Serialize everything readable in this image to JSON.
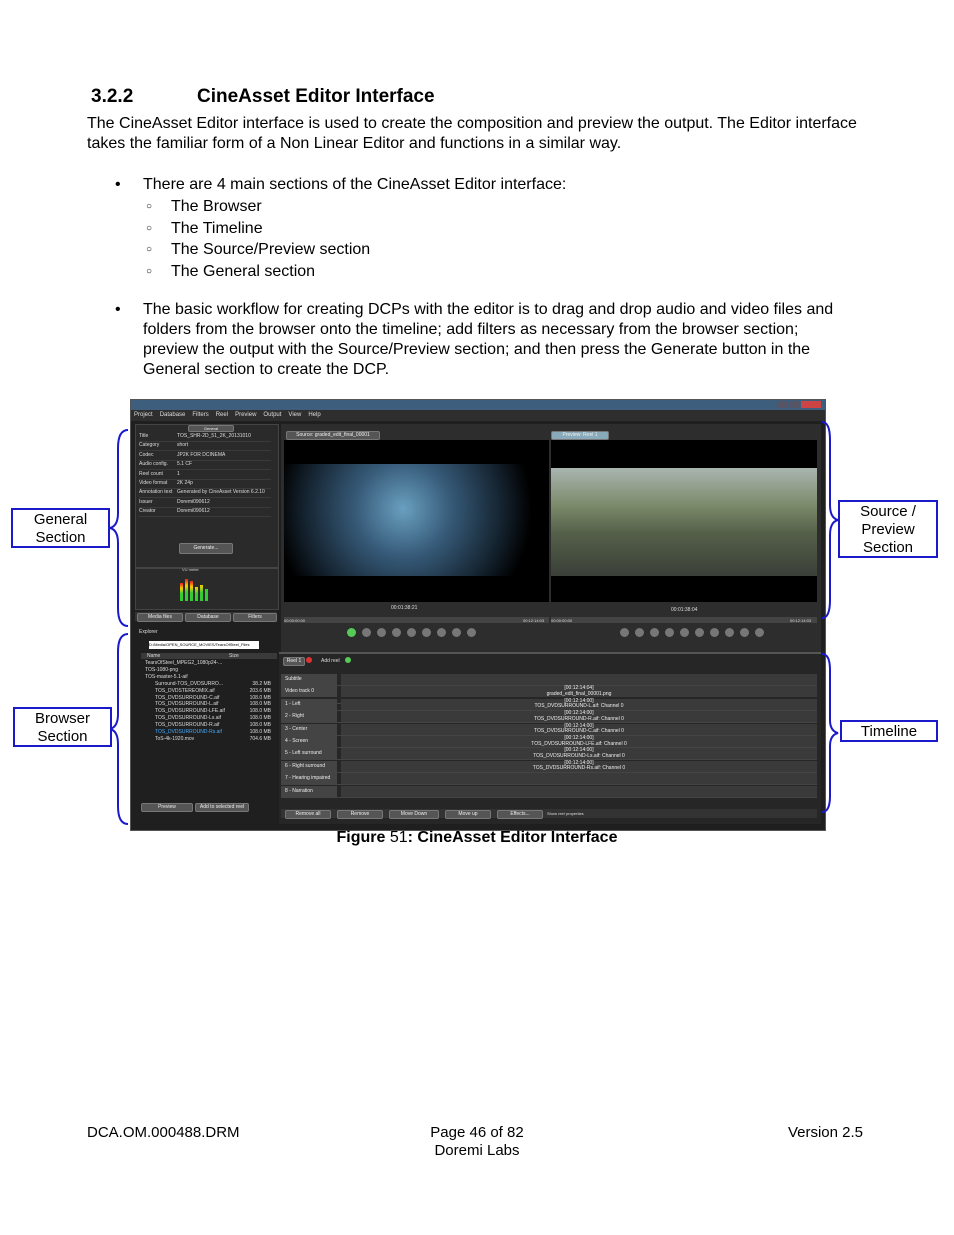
{
  "section": {
    "number": "3.2.2",
    "title": "CineAsset Editor Interface"
  },
  "intro": "The CineAsset Editor interface is used to create the composition and preview the output. The Editor interface takes the familiar form of a Non Linear Editor and functions in a similar way.",
  "bullet1": {
    "text": "There are 4 main sections of the CineAsset Editor interface:",
    "items": [
      "The Browser",
      "The Timeline",
      "The Source/Preview section",
      "The General section"
    ]
  },
  "bullet2": "The basic workflow for creating DCPs with the editor is to drag and drop audio and video files and folders from the browser onto the timeline; add filters as necessary from the browser section; preview the output with the Source/Preview section; and then press the Generate button in the General section to create the DCP.",
  "callouts": {
    "general": "General Section",
    "source": "Source / Preview Section",
    "browser": "Browser Section",
    "timeline": "Timeline"
  },
  "caption": {
    "label": "Figure",
    "number": "51",
    "sep": ":",
    "title": "CineAsset Editor Interface"
  },
  "footer": {
    "left": "DCA.OM.000488.DRM",
    "center1": "Page 46 of 82",
    "center2": "Doremi Labs",
    "right": "Version 2.5"
  },
  "screenshot": {
    "menu": [
      "Project",
      "Database",
      "Filters",
      "Reel",
      "Preview",
      "Output",
      "View",
      "Help"
    ],
    "general_tab": "General",
    "properties": [
      {
        "k": "Title",
        "v": "TOS_SHR-2D_51_2K_20131010"
      },
      {
        "k": "Category",
        "v": "short"
      },
      {
        "k": "Codec",
        "v": "JP2K FOR DCINEMA"
      },
      {
        "k": "Audio config.",
        "v": "5.1 CF"
      },
      {
        "k": "Reel count",
        "v": "1"
      },
      {
        "k": "Video format",
        "v": "2K 24p"
      },
      {
        "k": "Annotation text",
        "v": "Generated by CineAsset Version 6.2.10"
      },
      {
        "k": "Issuer",
        "v": "Doremi090612"
      },
      {
        "k": "Creator",
        "v": "Doremi090612"
      }
    ],
    "generate_btn": "Generate...",
    "vu_label": "VU meter",
    "source_tab": "Source: graded_edit_final_00001",
    "preview_tab": "Preview: Reel 1",
    "source_tc": "00:01:38:21",
    "preview_tc": "00:01:38:04",
    "tc_start": "00:00:00:00",
    "tc_end": "00:12:14:03",
    "browser_tabs": [
      "Media files",
      "Database",
      "Filters"
    ],
    "explorer_label": "Explorer",
    "path": "D:/Media/OPEN_SOURCE_MOVIES/TearsOfSteel_Files",
    "file_header": {
      "name": "Name",
      "size": "Size"
    },
    "files": [
      {
        "n": "TearsOfSteel_MPEG2_1080p24-...",
        "s": ""
      },
      {
        "n": "TOS-1080-png",
        "s": ""
      },
      {
        "n": "TOS-master-5.1-aif",
        "s": ""
      },
      {
        "n": "Surround-TOS_DVDSURRO...",
        "s": "38.2 MB"
      },
      {
        "n": "TOS_DVDSTEREOMIX.aif",
        "s": "203.6 MB"
      },
      {
        "n": "TOS_DVDSURROUND-C.aif",
        "s": "108.0 MB"
      },
      {
        "n": "TOS_DVDSURROUND-L.aif",
        "s": "108.0 MB"
      },
      {
        "n": "TOS_DVDSURROUND-LFE.aif",
        "s": "108.0 MB"
      },
      {
        "n": "TOS_DVDSURROUND-Ls.aif",
        "s": "108.0 MB"
      },
      {
        "n": "TOS_DVDSURROUND-R.aif",
        "s": "108.0 MB"
      },
      {
        "n": "TOS_DVDSURROUND-Rs.aif",
        "s": "108.0 MB"
      },
      {
        "n": "ToS-4k-1920.mov",
        "s": "704.6 MB"
      }
    ],
    "preview_btn": "Preview",
    "add_btn": "Add to selected reel",
    "reel_tab": "Reel 1",
    "add_reel": "Add reel",
    "tracks": [
      {
        "l": "Subtitle",
        "e1": "",
        "e2": ""
      },
      {
        "l": "Video track 0",
        "e1": "[00:12:14:04]",
        "e2": "graded_edit_final_00001.png"
      },
      {
        "l": "1 - Left",
        "e1": "[00:12:14:00]",
        "e2": "TOS_DVDSURROUND-L.aif: Channel 0"
      },
      {
        "l": "2 - Right",
        "e1": "[00:12:14:00]",
        "e2": "TOS_DVDSURROUND-R.aif: Channel 0"
      },
      {
        "l": "3 - Center",
        "e1": "[00:12:14:00]",
        "e2": "TOS_DVDSURROUND-C.aif: Channel 0"
      },
      {
        "l": "4 - Screen",
        "e1": "[00:12:14:00]",
        "e2": "TOS_DVDSURROUND-LFE.aif: Channel 0"
      },
      {
        "l": "5 - Left surround",
        "e1": "[00:12:14:00]",
        "e2": "TOS_DVDSURROUND-Ls.aif: Channel 0"
      },
      {
        "l": "6 - Right surround",
        "e1": "[00:12:14:00]",
        "e2": "TOS_DVDSURROUND-Rs.aif: Channel 0"
      },
      {
        "l": "7 - Hearing impaired",
        "e1": "",
        "e2": ""
      },
      {
        "l": "8 - Narration",
        "e1": "",
        "e2": ""
      }
    ],
    "bottom_btns": [
      "Remove all",
      "Remove",
      "Move Down",
      "Move up",
      "Effects..."
    ],
    "show_props": "Show reel properties"
  }
}
